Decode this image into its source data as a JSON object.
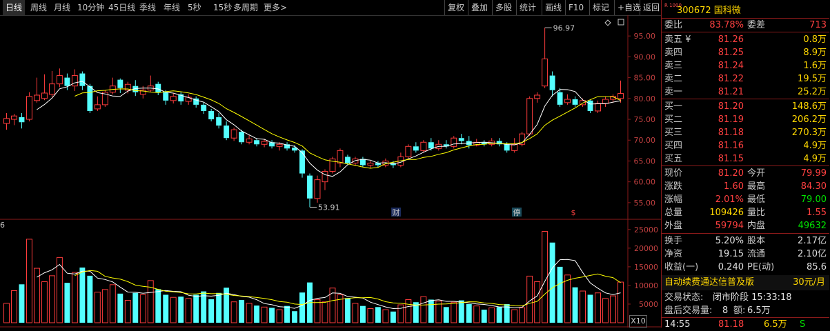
{
  "toolbar": {
    "periods": [
      "日线",
      "周线",
      "月线",
      "10分钟",
      "45日线",
      "季线",
      "年线",
      "5秒",
      "15秒",
      "多周期",
      "更多>"
    ],
    "tools": [
      "复权",
      "叠加",
      "多股",
      "统计",
      "画线",
      "F10",
      "标记",
      "+自选",
      "返回"
    ]
  },
  "chart": {
    "price_ticks": [
      "95.00",
      "90.00",
      "85.00",
      "80.00",
      "75.00",
      "70.00",
      "65.00",
      "60.00",
      "55.00"
    ],
    "vol_ticks": [
      "25000",
      "20000",
      "15000",
      "10000",
      "5000"
    ],
    "high_label": "96.97",
    "low_label": "53.91",
    "markers": [
      "财",
      "停",
      "$"
    ],
    "vol_unit_left": "6",
    "vol_unit_right": "X10"
  },
  "chart_data": {
    "type": "candlestick",
    "ylim": [
      52,
      99
    ],
    "vol_ylim": [
      0,
      27000
    ],
    "candles": [
      {
        "o": 74.0,
        "c": 75.2,
        "h": 76.5,
        "l": 72.5,
        "v": 5200
      },
      {
        "o": 75.0,
        "c": 75.8,
        "h": 76.3,
        "l": 73.6,
        "v": 8600
      },
      {
        "o": 75.5,
        "c": 74.3,
        "h": 76.5,
        "l": 72.8,
        "v": 10300
      },
      {
        "o": 75.0,
        "c": 80.5,
        "h": 81.5,
        "l": 74.5,
        "v": 22400
      },
      {
        "o": 79.5,
        "c": 80.8,
        "h": 85.0,
        "l": 79.0,
        "v": 14600
      },
      {
        "o": 80.0,
        "c": 81.3,
        "h": 85.8,
        "l": 79.6,
        "v": 11000
      },
      {
        "o": 81.0,
        "c": 83.5,
        "h": 86.6,
        "l": 80.3,
        "v": 12600
      },
      {
        "o": 83.5,
        "c": 85.5,
        "h": 87.2,
        "l": 82.7,
        "v": 17500
      },
      {
        "o": 85.0,
        "c": 83.0,
        "h": 86.0,
        "l": 82.0,
        "v": 10700
      },
      {
        "o": 83.0,
        "c": 85.5,
        "h": 87.0,
        "l": 81.8,
        "v": 13500
      },
      {
        "o": 86.0,
        "c": 83.0,
        "h": 86.5,
        "l": 82.0,
        "v": 14800
      },
      {
        "o": 83.0,
        "c": 77.0,
        "h": 83.5,
        "l": 76.5,
        "v": 12600
      },
      {
        "o": 77.5,
        "c": 78.5,
        "h": 80.5,
        "l": 77.0,
        "v": 8200
      },
      {
        "o": 78.5,
        "c": 81.5,
        "h": 82.0,
        "l": 78.0,
        "v": 8900
      },
      {
        "o": 81.5,
        "c": 83.0,
        "h": 85.0,
        "l": 81.0,
        "v": 10200
      },
      {
        "o": 84.5,
        "c": 82.5,
        "h": 84.8,
        "l": 81.3,
        "v": 7800
      },
      {
        "o": 82.0,
        "c": 83.4,
        "h": 84.0,
        "l": 81.2,
        "v": 6000
      },
      {
        "o": 83.0,
        "c": 81.5,
        "h": 84.4,
        "l": 80.6,
        "v": 8000
      },
      {
        "o": 81.0,
        "c": 82.0,
        "h": 83.0,
        "l": 80.0,
        "v": 7500
      },
      {
        "o": 82.0,
        "c": 83.0,
        "h": 85.5,
        "l": 81.5,
        "v": 11300
      },
      {
        "o": 83.5,
        "c": 81.5,
        "h": 84.0,
        "l": 80.8,
        "v": 9000
      },
      {
        "o": 81.5,
        "c": 79.5,
        "h": 82.0,
        "l": 78.5,
        "v": 7500
      },
      {
        "o": 79.5,
        "c": 80.5,
        "h": 81.2,
        "l": 78.8,
        "v": 6800
      },
      {
        "o": 81.0,
        "c": 79.3,
        "h": 81.5,
        "l": 78.5,
        "v": 7000
      },
      {
        "o": 79.3,
        "c": 80.3,
        "h": 81.0,
        "l": 78.5,
        "v": 6500
      },
      {
        "o": 80.0,
        "c": 78.5,
        "h": 80.5,
        "l": 77.8,
        "v": 7500
      },
      {
        "o": 78.5,
        "c": 77.0,
        "h": 79.0,
        "l": 76.3,
        "v": 8400
      },
      {
        "o": 77.0,
        "c": 75.0,
        "h": 77.5,
        "l": 74.5,
        "v": 6300
      },
      {
        "o": 75.5,
        "c": 73.5,
        "h": 76.5,
        "l": 72.8,
        "v": 8000
      },
      {
        "o": 73.5,
        "c": 70.5,
        "h": 74.5,
        "l": 70.0,
        "v": 9400
      },
      {
        "o": 70.5,
        "c": 72.5,
        "h": 73.0,
        "l": 69.8,
        "v": 5600
      },
      {
        "o": 72.0,
        "c": 69.5,
        "h": 72.5,
        "l": 69.0,
        "v": 6100
      },
      {
        "o": 69.5,
        "c": 70.3,
        "h": 71.2,
        "l": 69.0,
        "v": 5200
      },
      {
        "o": 70.0,
        "c": 69.0,
        "h": 70.5,
        "l": 68.5,
        "v": 4600
      },
      {
        "o": 69.0,
        "c": 69.7,
        "h": 70.3,
        "l": 68.3,
        "v": 4200
      },
      {
        "o": 69.5,
        "c": 68.5,
        "h": 70.0,
        "l": 68.0,
        "v": 4000
      },
      {
        "o": 68.5,
        "c": 69.0,
        "h": 69.5,
        "l": 67.5,
        "v": 3500
      },
      {
        "o": 69.0,
        "c": 68.0,
        "h": 69.5,
        "l": 67.5,
        "v": 4500
      },
      {
        "o": 68.2,
        "c": 67.5,
        "h": 68.8,
        "l": 67.0,
        "v": 3100
      },
      {
        "o": 67.5,
        "c": 62.0,
        "h": 67.8,
        "l": 61.0,
        "v": 8100
      },
      {
        "o": 61.5,
        "c": 56.0,
        "h": 62.0,
        "l": 53.91,
        "v": 10800
      },
      {
        "o": 56.0,
        "c": 60.5,
        "h": 61.5,
        "l": 55.0,
        "v": 6200
      },
      {
        "o": 60.0,
        "c": 62.5,
        "h": 63.0,
        "l": 58.0,
        "v": 5600
      },
      {
        "o": 62.5,
        "c": 65.5,
        "h": 66.0,
        "l": 62.0,
        "v": 9300
      },
      {
        "o": 64.5,
        "c": 67.5,
        "h": 68.0,
        "l": 63.5,
        "v": 7500
      },
      {
        "o": 66.0,
        "c": 64.5,
        "h": 66.5,
        "l": 64.0,
        "v": 6600
      },
      {
        "o": 64.5,
        "c": 65.5,
        "h": 66.0,
        "l": 63.8,
        "v": 5200
      },
      {
        "o": 65.5,
        "c": 64.0,
        "h": 66.0,
        "l": 63.5,
        "v": 4500
      },
      {
        "o": 64.0,
        "c": 64.5,
        "h": 65.0,
        "l": 63.2,
        "v": 3800
      },
      {
        "o": 64.5,
        "c": 64.0,
        "h": 65.0,
        "l": 63.5,
        "v": 4200
      },
      {
        "o": 64.0,
        "c": 65.0,
        "h": 65.6,
        "l": 63.5,
        "v": 3500
      },
      {
        "o": 64.5,
        "c": 64.0,
        "h": 65.0,
        "l": 63.3,
        "v": 3000
      },
      {
        "o": 64.0,
        "c": 66.0,
        "h": 67.0,
        "l": 63.5,
        "v": 4800
      },
      {
        "o": 66.0,
        "c": 68.5,
        "h": 69.0,
        "l": 65.5,
        "v": 6200
      },
      {
        "o": 68.5,
        "c": 67.5,
        "h": 69.5,
        "l": 67.0,
        "v": 5500
      },
      {
        "o": 67.5,
        "c": 69.5,
        "h": 70.0,
        "l": 67.0,
        "v": 7000
      },
      {
        "o": 69.5,
        "c": 68.0,
        "h": 70.5,
        "l": 67.5,
        "v": 6200
      },
      {
        "o": 68.0,
        "c": 69.0,
        "h": 70.0,
        "l": 67.5,
        "v": 5800
      },
      {
        "o": 69.0,
        "c": 68.5,
        "h": 70.0,
        "l": 68.0,
        "v": 4200
      },
      {
        "o": 68.5,
        "c": 70.5,
        "h": 71.0,
        "l": 68.0,
        "v": 5500
      },
      {
        "o": 70.5,
        "c": 69.8,
        "h": 71.5,
        "l": 69.0,
        "v": 6000
      },
      {
        "o": 69.8,
        "c": 68.8,
        "h": 71.0,
        "l": 68.0,
        "v": 5000
      },
      {
        "o": 68.8,
        "c": 69.5,
        "h": 70.3,
        "l": 68.5,
        "v": 4500
      },
      {
        "o": 69.5,
        "c": 69.0,
        "h": 70.0,
        "l": 68.5,
        "v": 3500
      },
      {
        "o": 69.0,
        "c": 69.8,
        "h": 70.5,
        "l": 68.5,
        "v": 4000
      },
      {
        "o": 69.8,
        "c": 69.0,
        "h": 70.5,
        "l": 68.5,
        "v": 4200
      },
      {
        "o": 69.0,
        "c": 67.5,
        "h": 69.5,
        "l": 67.0,
        "v": 5000
      },
      {
        "o": 67.5,
        "c": 69.0,
        "h": 70.5,
        "l": 67.0,
        "v": 3500
      },
      {
        "o": 69.0,
        "c": 71.5,
        "h": 72.0,
        "l": 68.5,
        "v": 4000
      },
      {
        "o": 71.5,
        "c": 80.0,
        "h": 80.5,
        "l": 71.0,
        "v": 12500
      },
      {
        "o": 80.0,
        "c": 80.8,
        "h": 81.5,
        "l": 79.0,
        "v": 11000
      },
      {
        "o": 83.0,
        "c": 89.5,
        "h": 96.97,
        "l": 82.5,
        "v": 24500
      },
      {
        "o": 85.5,
        "c": 82.0,
        "h": 86.5,
        "l": 80.5,
        "v": 21500
      },
      {
        "o": 81.5,
        "c": 78.5,
        "h": 82.5,
        "l": 78.0,
        "v": 15000
      },
      {
        "o": 79.0,
        "c": 79.8,
        "h": 81.0,
        "l": 78.5,
        "v": 12800
      },
      {
        "o": 79.8,
        "c": 78.5,
        "h": 80.5,
        "l": 78.0,
        "v": 9500
      },
      {
        "o": 78.5,
        "c": 79.5,
        "h": 80.0,
        "l": 78.0,
        "v": 8500
      },
      {
        "o": 79.5,
        "c": 77.0,
        "h": 79.8,
        "l": 76.5,
        "v": 7500
      },
      {
        "o": 77.0,
        "c": 78.8,
        "h": 79.5,
        "l": 76.5,
        "v": 8000
      },
      {
        "o": 78.8,
        "c": 79.8,
        "h": 80.5,
        "l": 78.0,
        "v": 6500
      },
      {
        "o": 79.8,
        "c": 80.5,
        "h": 81.0,
        "l": 79.0,
        "v": 7200
      },
      {
        "o": 79.99,
        "c": 81.2,
        "h": 84.3,
        "l": 79.0,
        "v": 10900
      }
    ]
  },
  "panel": {
    "badge": "R 1000",
    "code": "300672",
    "name": "国科微",
    "weibi_label": "委比",
    "weibi": "83.78%",
    "weicha_label": "委差",
    "weicha": "713",
    "asks": [
      {
        "label": "卖五 ¥",
        "price": "81.26",
        "vol": "0.8万"
      },
      {
        "label": "卖四",
        "price": "81.25",
        "vol": "8.9万"
      },
      {
        "label": "卖三",
        "price": "81.24",
        "vol": "1.6万"
      },
      {
        "label": "卖二",
        "price": "81.22",
        "vol": "19.5万"
      },
      {
        "label": "卖一",
        "price": "81.21",
        "vol": "25.2万"
      }
    ],
    "bids": [
      {
        "label": "买一",
        "price": "81.20",
        "vol": "148.6万"
      },
      {
        "label": "买二",
        "price": "81.19",
        "vol": "206.2万"
      },
      {
        "label": "买三",
        "price": "81.18",
        "vol": "270.3万"
      },
      {
        "label": "买四",
        "price": "81.16",
        "vol": "4.9万"
      },
      {
        "label": "买五",
        "price": "81.15",
        "vol": "4.9万"
      }
    ],
    "stats": [
      {
        "l1": "现价",
        "v1": "81.20",
        "c1": "red",
        "l2": "今开",
        "v2": "79.99",
        "c2": "red"
      },
      {
        "l1": "涨跌",
        "v1": "1.60",
        "c1": "red",
        "l2": "最高",
        "v2": "84.30",
        "c2": "red"
      },
      {
        "l1": "涨幅",
        "v1": "2.01%",
        "c1": "red",
        "l2": "最低",
        "v2": "79.00",
        "c2": "green"
      },
      {
        "l1": "总量",
        "v1": "109426",
        "c1": "yellow",
        "l2": "量比",
        "v2": "1.55",
        "c2": "red"
      },
      {
        "l1": "外盘",
        "v1": "59794",
        "c1": "red",
        "l2": "内盘",
        "v2": "49632",
        "c2": "green"
      }
    ],
    "stats2": [
      {
        "l1": "换手",
        "v1": "5.20%",
        "l2": "股本",
        "v2": "2.17亿"
      },
      {
        "l1": "净资",
        "v1": "19.15",
        "l2": "流通",
        "v2": "2.10亿"
      },
      {
        "l1": "收益(一)",
        "v1": "0.240",
        "l2": "PE(动)",
        "v2": "85.6"
      }
    ],
    "ad_text": "自动续费通达信普及版",
    "ad_price": "30元/月",
    "trade_status_label": "交易状态:",
    "trade_status": "闭市阶段 15:33:18",
    "after_label": "盘后交易量:",
    "after_vol": "8",
    "after_amt_label": "额:",
    "after_amt": "6.5万",
    "tick_time": "14:55",
    "tick_price": "81.18",
    "tick_vol": "6.5万",
    "tick_flag": "S"
  }
}
